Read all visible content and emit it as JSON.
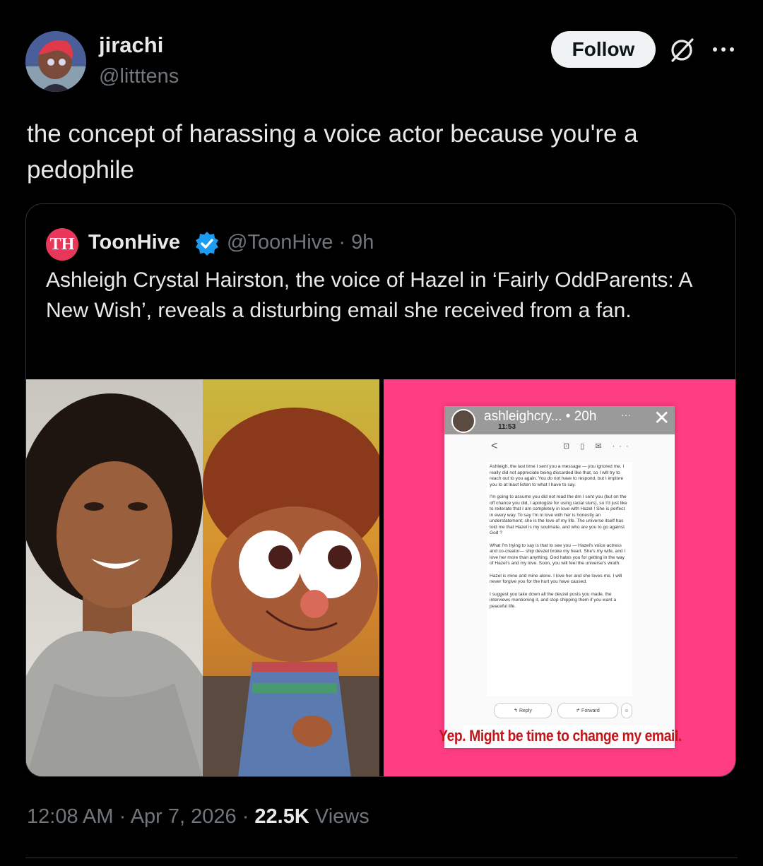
{
  "author": {
    "name": "jirachi",
    "handle": "@litttens"
  },
  "actions": {
    "follow_label": "Follow"
  },
  "tweet": {
    "text": "the concept of harassing a voice actor because you're a pedophile"
  },
  "quote": {
    "logo_text": "TH",
    "name": "ToonHive",
    "handle_time": "@ToonHive · 9h",
    "text": "Ashleigh Crystal Hairston, the voice of Hazel in ‘Fairly OddParents: A New Wish’, reveals a disturbing email she received from a fan.",
    "story": {
      "user": "ashleighcry... • 20h",
      "clock": "11:53",
      "more": "···",
      "close": "✕",
      "back": "<",
      "toolbar_icons": "⊡ ▯ ✉ ···",
      "paragraphs": [
        "Ashleigh, the last time I sent you a message — you ignored me. I really did not appreciate being discarded like that, so I will try to reach out to you again. You do not have to respond, but I implore you to at least listen to what I have to say.",
        "I'm going to assume you did not read the dm I sent you (but on the off chance you did, I apologize for using racial slurs), so I'd just like to reiterate that I am completely in love with Hazel ! She is perfect in every way. To say I'm in love with her is honestly an understatement; she is the love of my life. The universe itself has told me that Hazel is my soulmate, and who are you to go against God ?",
        "What I'm trying to say is that to see you — Hazel's voice actress and co-creator— ship devzel broke my heart. She's my wife, and I love her more than anything. God hates you for getting in the way of Hazel's and my love. Soon, you will feel the universe's wrath.",
        "Hazel is mine and mine alone. I love her and she loves me. I will never forgive you for the hurt you have caused.",
        "I suggest you take down all the devzel posts you made, the interviews mentioning it, and stop shipping them if you want a peaceful life."
      ],
      "reply_label": "↰ Reply",
      "forward_label": "↱ Forward",
      "caption": "Yep. Might be time to change my email."
    }
  },
  "meta": {
    "time": "12:08 AM · Apr 7, 2026 · ",
    "views_count": "22.5K",
    "views_label": " Views"
  },
  "colors": {
    "background": "#000000",
    "text": "#e7e9ea",
    "muted": "#71767b",
    "verified": "#1d9bf0",
    "pink": "#ff3d82",
    "caption_red": "#c0171c"
  }
}
